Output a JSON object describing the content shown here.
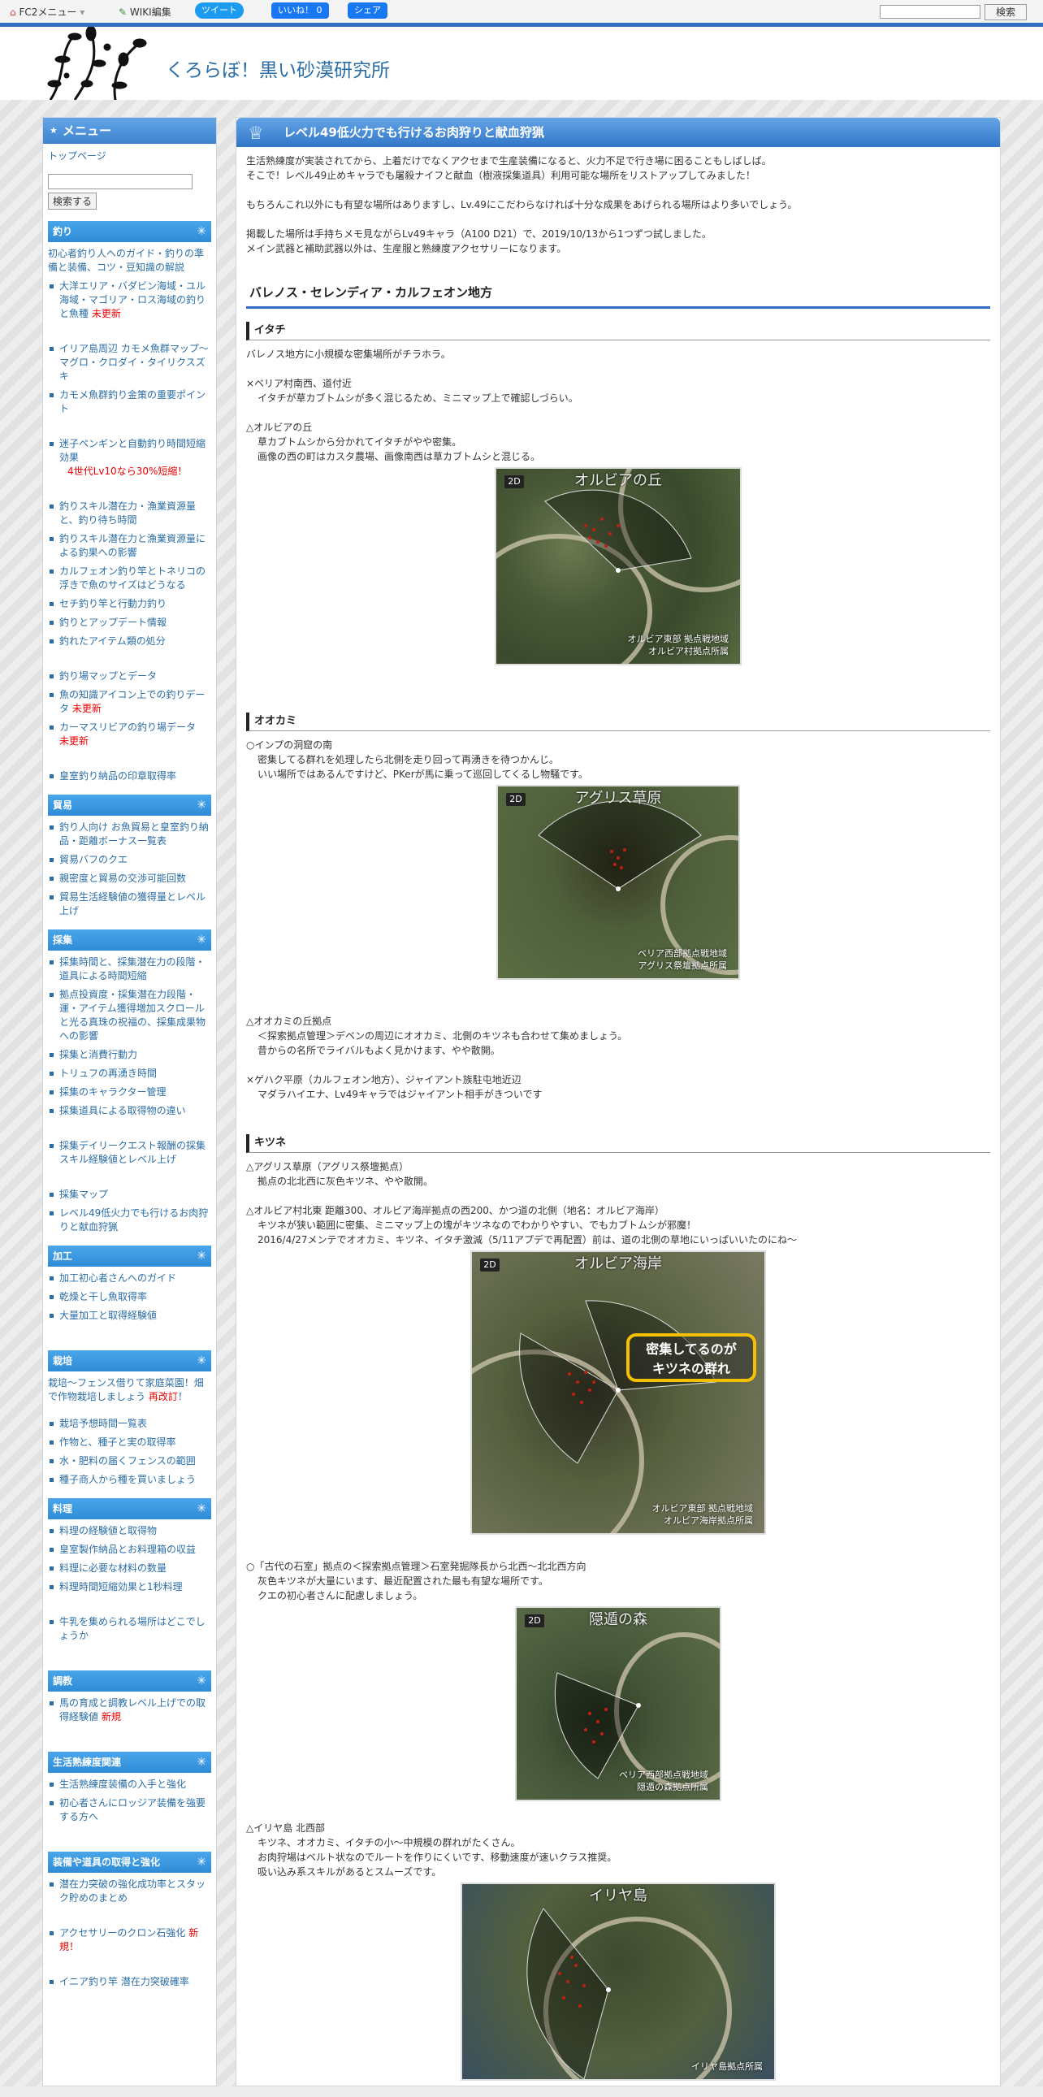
{
  "topbar": {
    "fc2_menu": "FC2メニュー",
    "wiki_edit": "WIKI編集",
    "tweet": "ツイート",
    "like": "いいね！ 0",
    "share": "シェア",
    "search_btn": "検索"
  },
  "site": {
    "title": "くろらぼ！黒い砂漠研究所"
  },
  "sidebar": {
    "menu_title": "メニュー",
    "top_page": "トップページ",
    "search_btn": "検索する",
    "sections": {
      "fishing": {
        "title": "釣り",
        "desc": "初心者釣り人へのガイド・釣りの準備と装備、コツ・豆知識の解説",
        "items": [
          "大洋エリア・バダビン海域・ユル海域・マゴリア・ロス海域の釣りと魚種",
          "未更新",
          "イリア島周辺 カモメ魚群マップ～マグロ・クロダイ・タイリクスズキ",
          "カモメ魚群釣り金策の重要ポイント",
          "迷子ペンギンと自動釣り時間短縮効果",
          "4世代Lv10なら30%短縮！",
          "釣りスキル潜在力・漁業資源量と、釣り待ち時間",
          "釣りスキル潜在力と漁業資源量による釣果への影響",
          "カルフェオン釣り竿とトネリコの浮きで魚のサイズはどうなる",
          "セチ釣り竿と行動力釣り",
          "釣りとアップデート情報",
          "釣れたアイテム類の処分",
          "釣り場マップとデータ",
          "魚の知識アイコン上での釣りデータ",
          "未更新",
          "カーマスリビアの釣り場データ",
          "未更新",
          "皇室釣り納品の印章取得率"
        ]
      },
      "trade": {
        "title": "貿易",
        "items": [
          "釣り人向け お魚貿易と皇室釣り納品・距離ボーナス一覧表",
          "貿易バフのクエ",
          "親密度と貿易の交渉可能回数",
          "貿易生活経験値の獲得量とレベル上げ"
        ]
      },
      "gather": {
        "title": "採集",
        "items": [
          "採集時間と、採集潜在力の段階・道具による時間短縮",
          "拠点投資度・採集潜在力段階・運・アイテム獲得増加スクロールと光る真珠の祝福の、採集成果物への影響",
          "採集と消費行動力",
          "トリュフの再湧き時間",
          "採集のキャラクター管理",
          "採集道具による取得物の違い",
          "採集デイリークエスト報酬の採集スキル経験値とレベル上げ",
          "採集マップ",
          "レベル49低火力でも行けるお肉狩りと献血狩猟"
        ]
      },
      "process": {
        "title": "加工",
        "items": [
          "加工初心者さんへのガイド",
          "乾燥と干し魚取得率",
          "大量加工と取得経験値"
        ]
      },
      "farm": {
        "title": "栽培",
        "desc": "栽培～フェンス借りて家庭菜園！畑で作物栽培しましょう",
        "desc_red": "再改訂",
        "desc_end": "！",
        "items": [
          "栽培予想時間一覧表",
          "作物と、種子と実の取得率",
          "水・肥料の届くフェンスの範囲",
          "種子商人から種を買いましょう"
        ]
      },
      "cook": {
        "title": "料理",
        "items": [
          "料理の経験値と取得物",
          "皇室製作納品とお料理箱の収益",
          "料理に必要な材料の数量",
          "料理時間短縮効果と1秒料理",
          "牛乳を集められる場所はどこでしょうか"
        ]
      },
      "train": {
        "title": "調教",
        "items": [
          "馬の育成と調教レベル上げでの取得経験値",
          "新規"
        ]
      },
      "life": {
        "title": "生活熟練度関連",
        "items": [
          "生活熟練度装備の入手と強化",
          "初心者さんにロッジア装備を強要する方へ"
        ]
      },
      "equip": {
        "title": "装備や道具の取得と強化",
        "items": [
          "潜在力突破の強化成功率とスタック貯めのまとめ",
          "アクセサリーのクロン石強化",
          "新規",
          "！",
          "イニア釣り竿 潜在力突破確率"
        ]
      }
    }
  },
  "article": {
    "title": "レベル49低火力でも行けるお肉狩りと献血狩猟",
    "intro1": "生活熟練度が実装されてから、上着だけでなくアクセまで生産装備になると、火力不足で行き場に困ることもしばしば。",
    "intro2": "そこで！レベル49止めキャラでも屠殺ナイフと献血（樹液採集道具）利用可能な場所をリストアップしてみました！",
    "intro3": "もちろんこれ以外にも有望な場所はありますし、Lv.49にこだわらなければ十分な成果をあげられる場所はより多いでしょう。",
    "intro4": "掲載した場所は手持ちメモ見ながらLv49キャラ（A100 D21）で、2019/10/13から1つずつ試しました。",
    "intro5": "メイン武器と補助武器以外は、生産服と熟練度アクセサリーになります。",
    "region": "バレノス・セレンディア・カルフェオン地方",
    "weasel": {
      "title": "イタチ",
      "lead": "バレノス地方に小規模な密集場所がチラホラ。",
      "p1a": "×ベリア村南西、道付近",
      "p1b": "イタチが草カブトムシが多く混じるため、ミニマップ上で確認しづらい。",
      "p2a": "△オルビアの丘",
      "p2b": "草カブトムシから分かれてイタチがやや密集。",
      "p2c": "画像の西の町はカスタ農場、画像南西は草カブトムシと混じる。",
      "map": {
        "badge": "2D",
        "name": "オルビアの丘",
        "cap1": "オルビア東部 拠点戦地域",
        "cap2": "オルビア村拠点所属"
      }
    },
    "wolf": {
      "title": "オオカミ",
      "p1a": "○インプの洞窟の南",
      "p1b": "密集してる群れを処理したら北側を走り回って再湧きを待つかんじ。",
      "p1c": "いい場所ではあるんですけど、PKerが馬に乗って巡回してくるし物騒です。",
      "map": {
        "badge": "2D",
        "name": "アグリス草原",
        "cap1": "ベリア西部拠点戦地域",
        "cap2": "アグリス祭壇拠点所属"
      },
      "p2a": "△オオカミの丘拠点",
      "p2b": "＜探索拠点管理＞デベンの周辺にオオカミ、北側のキツネも合わせて集めましょう。",
      "p2c": "昔からの名所でライバルもよく見かけます、やや散開。",
      "p3a": "×ゲハク平原（カルフェオン地方）、ジャイアント族駐屯地近辺",
      "p3b": "マダラハイエナ、Lv49キャラではジャイアント相手がきついです"
    },
    "fox": {
      "title": "キツネ",
      "p1a": "△アグリス草原（アグリス祭壇拠点）",
      "p1b": "拠点の北北西に灰色キツネ、やや散開。",
      "p2a": "△オルビア村北東 距離300、オルビア海岸拠点の西200、かつ道の北側（地名：オルビア海岸）",
      "p2b": "キツネが狭い範囲に密集、ミニマップ上の塊がキツネなのでわかりやすい、でもカブトムシが邪魔！",
      "p2c": "2016/4/27メンテでオオカミ、キツネ、イタチ激減（5/11アプデで再配置）前は、道の北側の草地にいっぱいいたのにね～",
      "map1": {
        "badge": "2D",
        "name": "オルビア海岸",
        "callout1": "密集してるのが",
        "callout2": "キツネの群れ",
        "cap1": "オルビア東部 拠点戦地域",
        "cap2": "オルビア海岸拠点所属"
      },
      "p3a": "○「古代の石室」拠点の＜探索拠点管理＞石室発掘隊長から北西～北北西方向",
      "p3b": "灰色キツネが大量にいます、最近配置された最も有望な場所です。",
      "p3c": "クエの初心者さんに配慮しましょう。",
      "map2": {
        "badge": "2D",
        "name": "隠遁の森",
        "cap1": "ベリア西部拠点戦地域",
        "cap2": "隠遁の森拠点所属"
      },
      "p4a": "△イリヤ島 北西部",
      "p4b": "キツネ、オオカミ、イタチの小～中規模の群れがたくさん。",
      "p4c": "お肉狩場はベルト状なのでルートを作りにくいです、移動速度が速いクラス推奨。",
      "p4d": "吸い込み系スキルがあるとスムーズです。",
      "map3": {
        "badge": "2D",
        "name": "イリヤ島",
        "cap1": "イリヤ島拠点所属"
      }
    }
  },
  "colors": {
    "accent": "#2f6fc3",
    "link": "#2b6ea6",
    "alert": "#ee0000"
  }
}
